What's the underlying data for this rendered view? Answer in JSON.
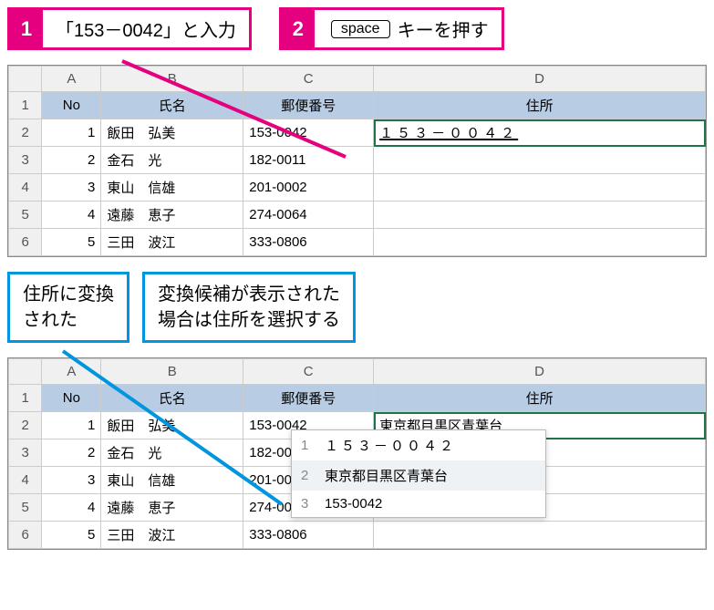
{
  "steps": {
    "s1": {
      "num": "1",
      "text_a": "「153－0042」と入力"
    },
    "s2": {
      "num": "2",
      "key": "space",
      "text_b": "キーを押す"
    }
  },
  "notes": {
    "n1": "住所に変換\nされた",
    "n2": "変換候補が表示された\n場合は住所を選択する"
  },
  "sheet": {
    "cols": {
      "A": "A",
      "B": "B",
      "C": "C",
      "D": "D"
    },
    "headers": {
      "no": "No",
      "name": "氏名",
      "postal": "郵便番号",
      "addr": "住所"
    },
    "rows": [
      {
        "r": "1"
      },
      {
        "r": "2",
        "no": "1",
        "name": "飯田　弘美",
        "postal": "153-0042"
      },
      {
        "r": "3",
        "no": "2",
        "name": "金石　光",
        "postal": "182-0011"
      },
      {
        "r": "4",
        "no": "3",
        "name": "東山　信雄",
        "postal": "201-0002"
      },
      {
        "r": "5",
        "no": "4",
        "name": "遠藤　恵子",
        "postal": "274-0064"
      },
      {
        "r": "6",
        "no": "5",
        "name": "三田　波江",
        "postal": "333-0806"
      }
    ],
    "active1": "１５３－００４２",
    "active2": "東京都目黒区青葉台"
  },
  "candidates": [
    {
      "n": "1",
      "text": "１５３－００４２"
    },
    {
      "n": "2",
      "text": "東京都目黒区青葉台"
    },
    {
      "n": "3",
      "text": "153-0042"
    }
  ]
}
